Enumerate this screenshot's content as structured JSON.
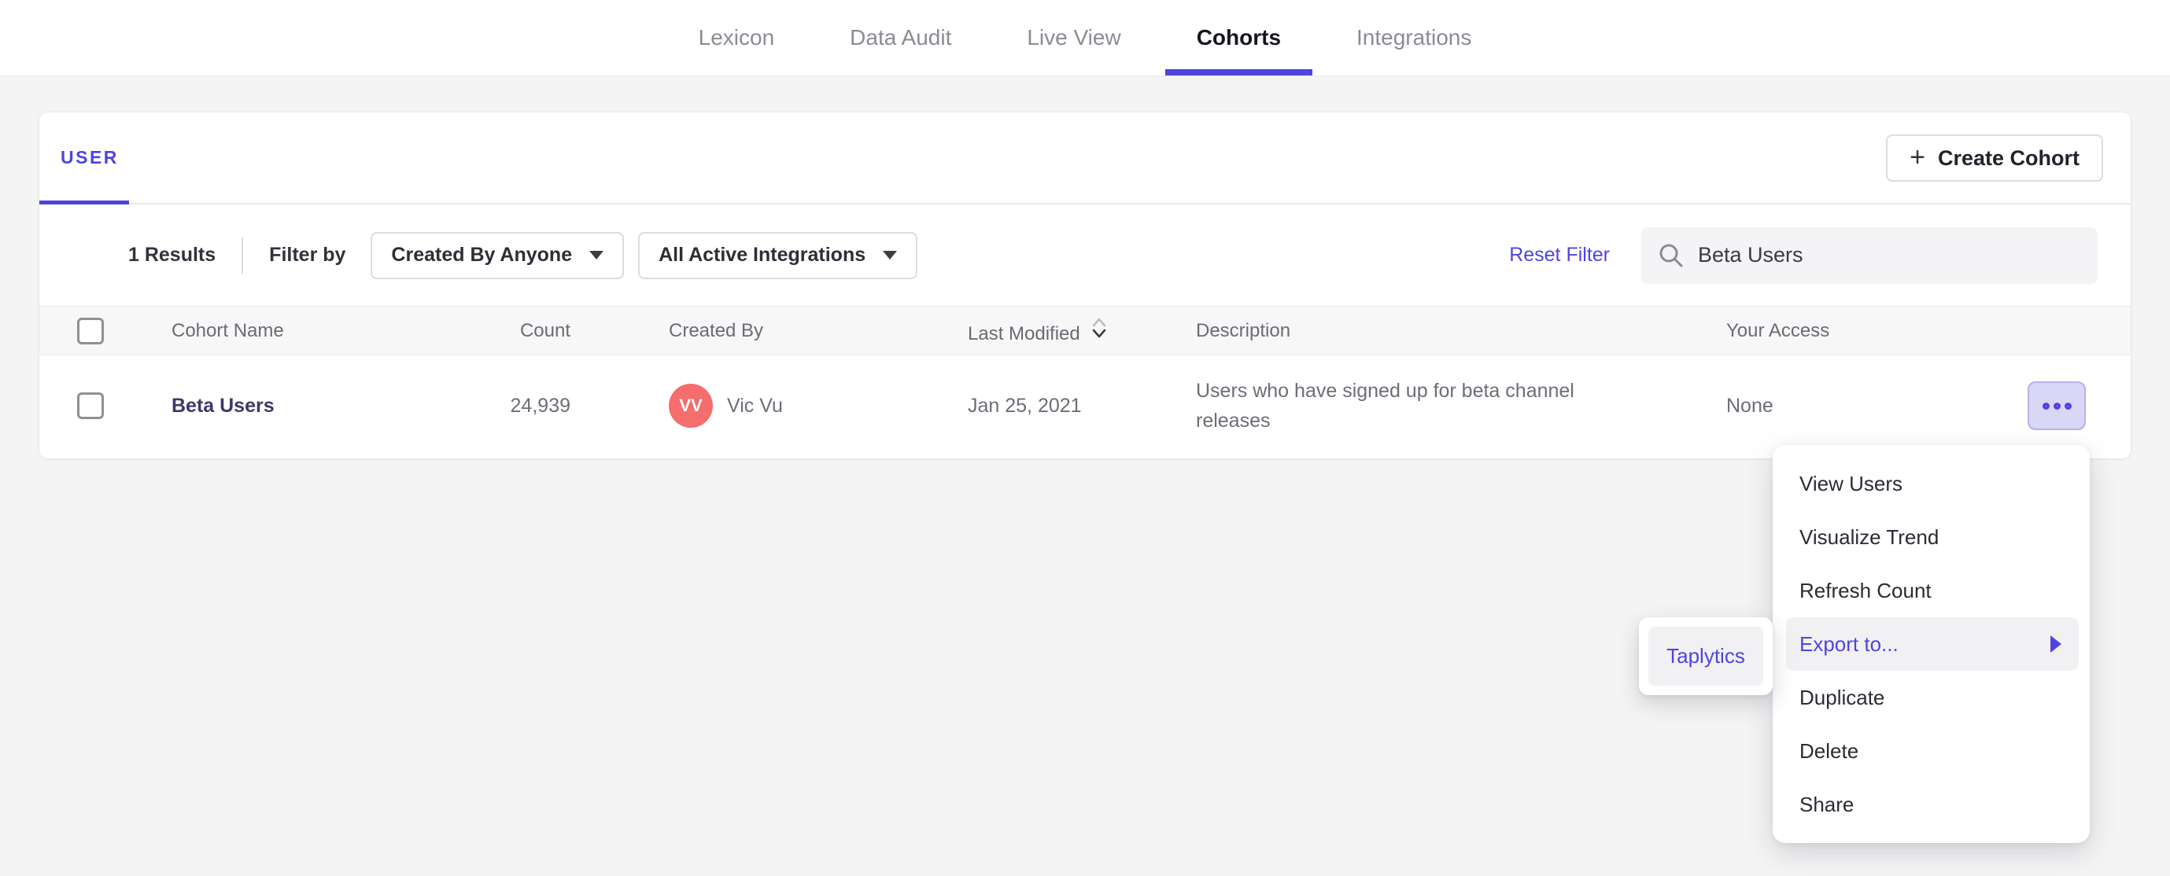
{
  "colors": {
    "accent": "#4f44e0",
    "avatar": "#f56d6c",
    "cohort-name": "#3c3968"
  },
  "nav": {
    "active": "Cohorts",
    "items": [
      {
        "label": "Lexicon"
      },
      {
        "label": "Data Audit"
      },
      {
        "label": "Live View"
      },
      {
        "label": "Cohorts"
      },
      {
        "label": "Integrations"
      }
    ]
  },
  "cohorts": {
    "tab_label": "USER",
    "create_button_label": "Create Cohort",
    "plus_icon": "+",
    "filters": {
      "results_count": "1 Results",
      "filter_by_label": "Filter by",
      "created_by_value": "Created By Anyone",
      "integrations_value": "All Active Integrations",
      "reset_label": "Reset Filter",
      "search_value": "Beta Users"
    },
    "table": {
      "headers": {
        "name": "Cohort Name",
        "count": "Count",
        "created_by": "Created By",
        "last_modified": "Last Modified",
        "description": "Description",
        "access": "Your Access"
      },
      "rows": [
        {
          "name": "Beta Users",
          "count": "24,939",
          "avatar_initials": "VV",
          "created_by": "Vic Vu",
          "last_modified": "Jan 25, 2021",
          "description": "Users who have signed up for beta channel releases",
          "access": "None"
        }
      ]
    }
  },
  "context_menu": {
    "highlighted_item": "Export to...",
    "items": [
      "View Users",
      "Visualize Trend",
      "Refresh Count",
      "Export to...",
      "Duplicate",
      "Delete",
      "Share"
    ],
    "submenu": {
      "highlighted_item": "Taplytics",
      "items": [
        "Taplytics"
      ]
    }
  },
  "icons": {
    "create_cohort": "plus",
    "dropdown_caret": "chevron-down",
    "search": "magnifier",
    "last_modified_sort": "sort-chevrons",
    "row_actions": "ellipsis-circles",
    "export_submenu": "triangle-right"
  }
}
